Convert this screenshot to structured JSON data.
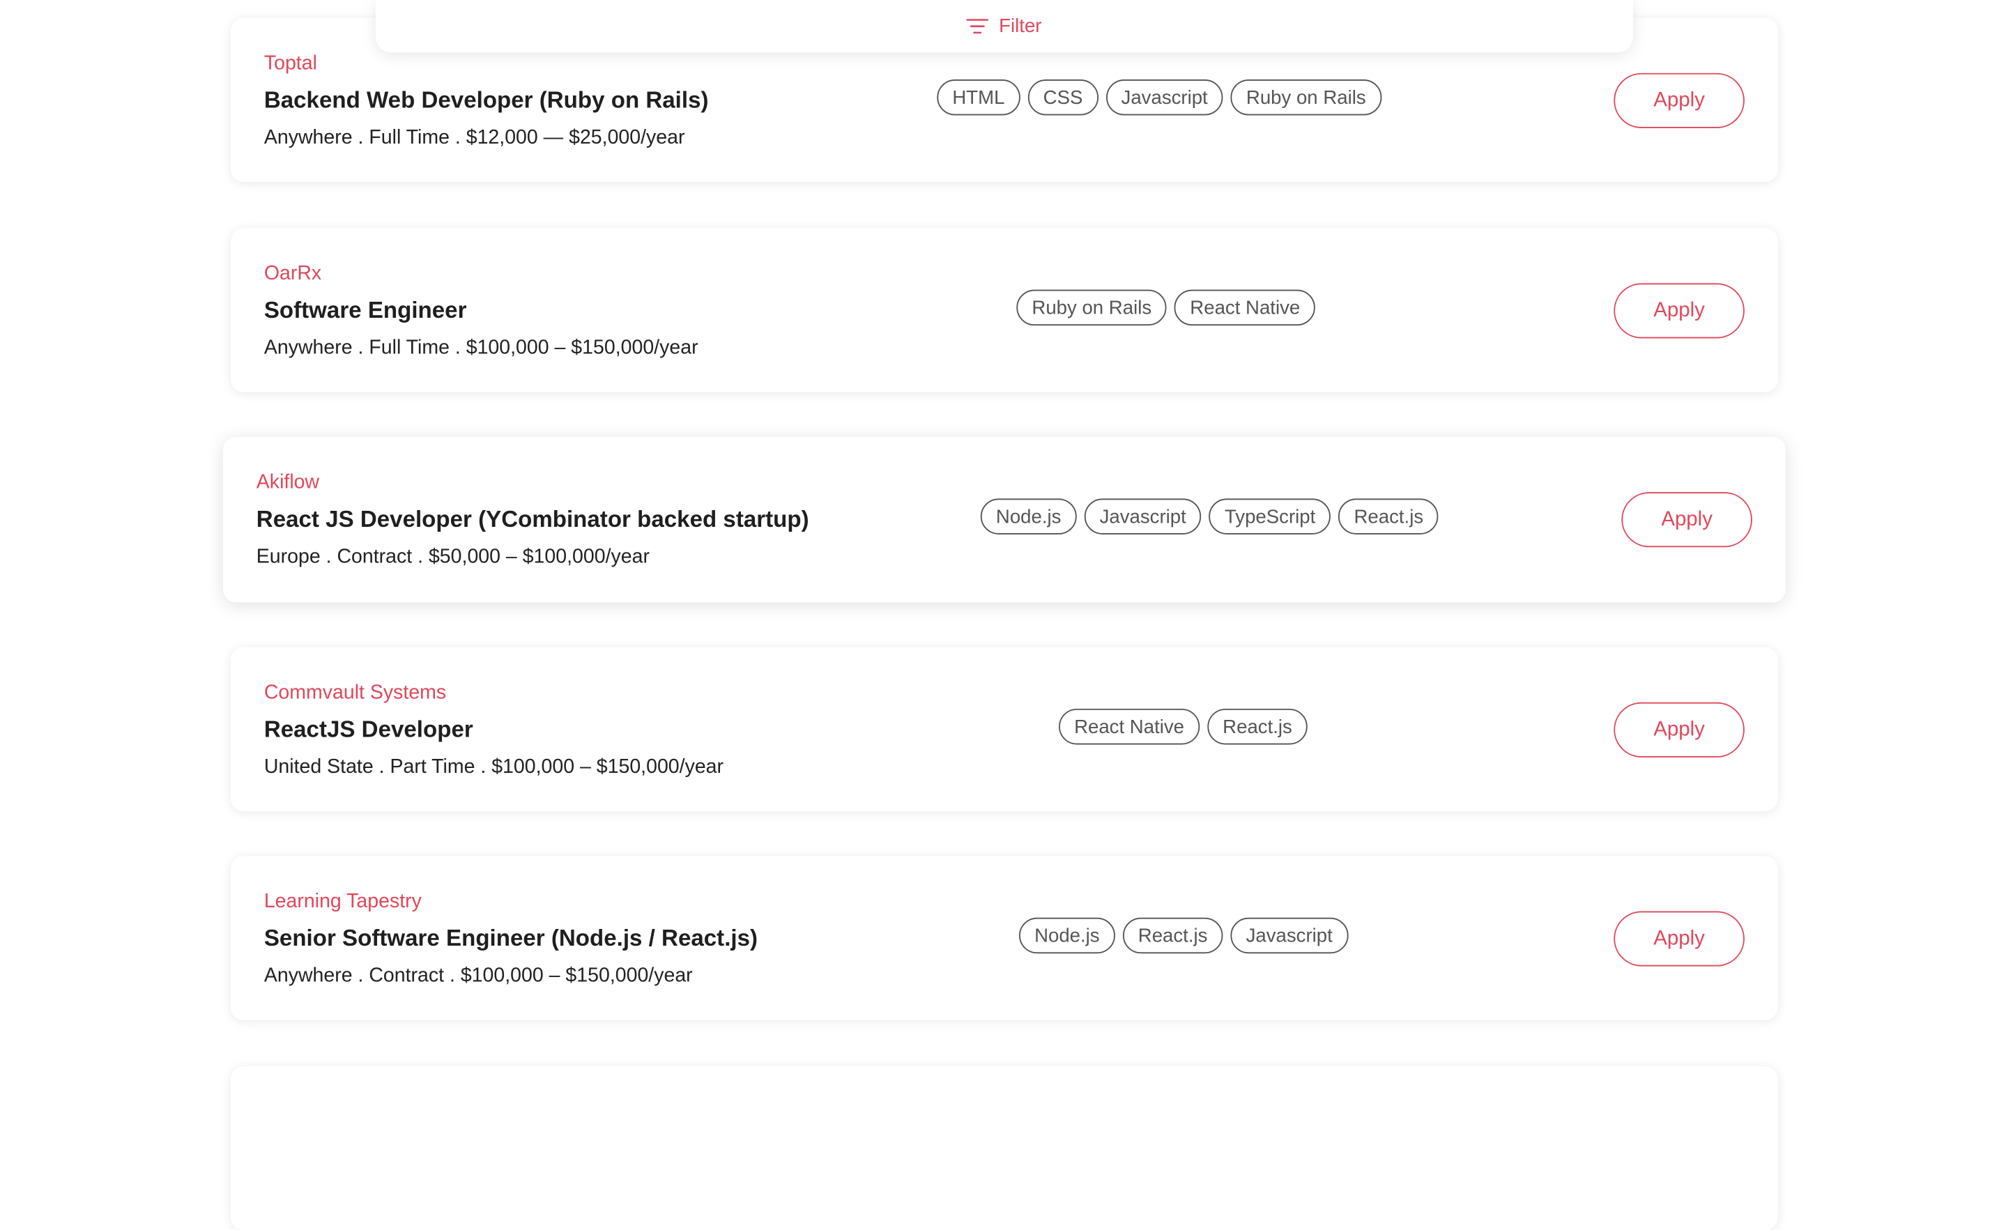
{
  "filter": {
    "label": "Filter",
    "icon": "filter-lines-icon"
  },
  "colors": {
    "accent": "#e0485a",
    "tag_border": "#555555",
    "text": "#1f1f1f"
  },
  "jobs": [
    {
      "company": "Toptal",
      "title": "Backend Web Developer (Ruby on Rails)",
      "meta": "Anywhere . Full Time . $12,000 — $25,000/year",
      "tags": [
        "HTML",
        "CSS",
        "Javascript",
        "Ruby on Rails"
      ],
      "apply_label": "Apply"
    },
    {
      "company": "OarRx",
      "title": "Software Engineer",
      "meta": "Anywhere . Full Time . $100,000 – $150,000/year",
      "tags": [
        "Ruby on Rails",
        "React Native"
      ],
      "apply_label": "Apply"
    },
    {
      "company": "Akiflow",
      "title": "React JS Developer (YCombinator backed startup)",
      "meta": "Europe . Contract . $50,000 – $100,000/year",
      "tags": [
        "Node.js",
        "Javascript",
        "TypeScript",
        "React.js"
      ],
      "apply_label": "Apply"
    },
    {
      "company": "Commvault Systems",
      "title": "ReactJS Developer",
      "meta": "United State . Part Time . $100,000 – $150,000/year",
      "tags": [
        "React Native",
        "React.js"
      ],
      "apply_label": "Apply"
    },
    {
      "company": "Learning Tapestry",
      "title": "Senior Software Engineer (Node.js / React.js)",
      "meta": "Anywhere . Contract . $100,000 – $150,000/year",
      "tags": [
        "Node.js",
        "React.js",
        "Javascript"
      ],
      "apply_label": "Apply"
    }
  ]
}
